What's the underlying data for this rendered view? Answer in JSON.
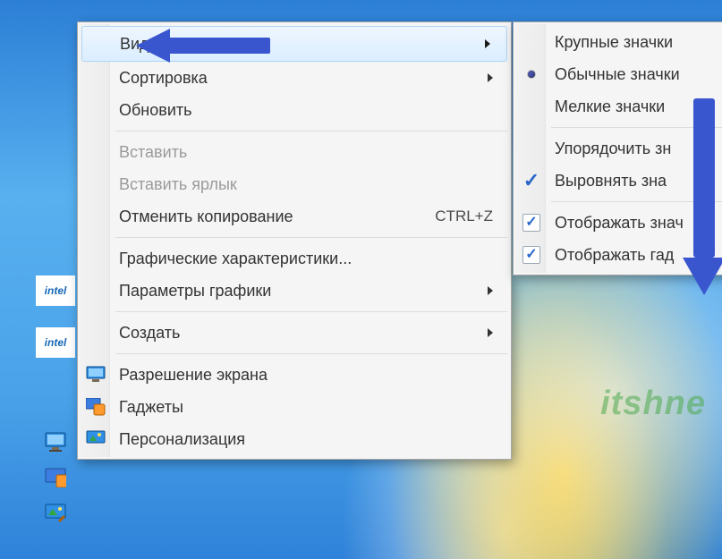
{
  "desktop": {
    "intel1_label": "intel",
    "intel2_label": "intel"
  },
  "watermark": "itshne",
  "main_menu": {
    "view": "Вид",
    "sort": "Сортировка",
    "refresh": "Обновить",
    "paste": "Вставить",
    "paste_shortcut": "Вставить ярлык",
    "undo_copy": "Отменить копирование",
    "undo_copy_shortcut": "CTRL+Z",
    "gfx_props": "Графические характеристики...",
    "gfx_params": "Параметры графики",
    "create": "Создать",
    "screen_res": "Разрешение экрана",
    "gadgets": "Гаджеты",
    "personalization": "Персонализация"
  },
  "sub_menu": {
    "large_icons": "Крупные значки",
    "medium_icons": "Обычные значки",
    "small_icons": "Мелкие значки",
    "auto_arrange": "Упорядочить зн",
    "align_to_grid": "Выровнять зна",
    "show_icons": "Отображать знач",
    "show_gadgets": "Отображать гад"
  }
}
